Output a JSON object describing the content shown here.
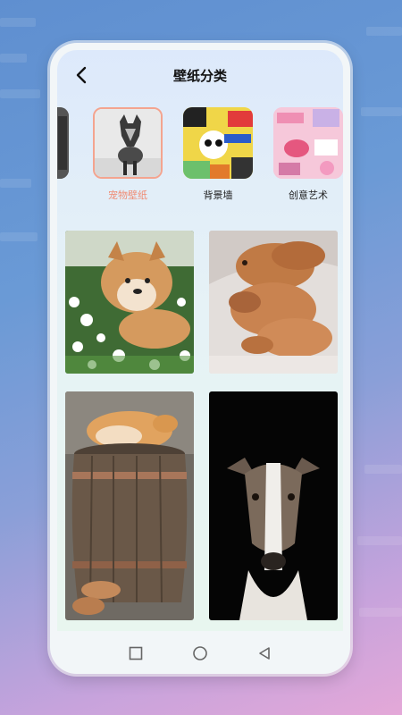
{
  "header": {
    "title": "壁纸分类"
  },
  "categories": [
    {
      "label": "",
      "icon": "partial-category-thumbnail"
    },
    {
      "label": "宠物壁纸",
      "icon": "wolf-dog-photo",
      "selected": true
    },
    {
      "label": "背景墙",
      "icon": "sticker-collage-photo"
    },
    {
      "label": "创意艺术",
      "icon": "pink-collage-photo"
    }
  ],
  "wallpapers": [
    {
      "icon": "shiba-in-flowers-photo"
    },
    {
      "icon": "sleeping-golden-retrievers-photo"
    },
    {
      "icon": "shiba-on-barrel-photo"
    },
    {
      "icon": "whippet-portrait-photo"
    }
  ],
  "colors": {
    "accent": "#f08c74",
    "selected_border": "#f4a48f"
  },
  "navbar": {
    "icons": [
      "square-recent-apps-icon",
      "circle-home-icon",
      "triangle-back-icon"
    ]
  }
}
